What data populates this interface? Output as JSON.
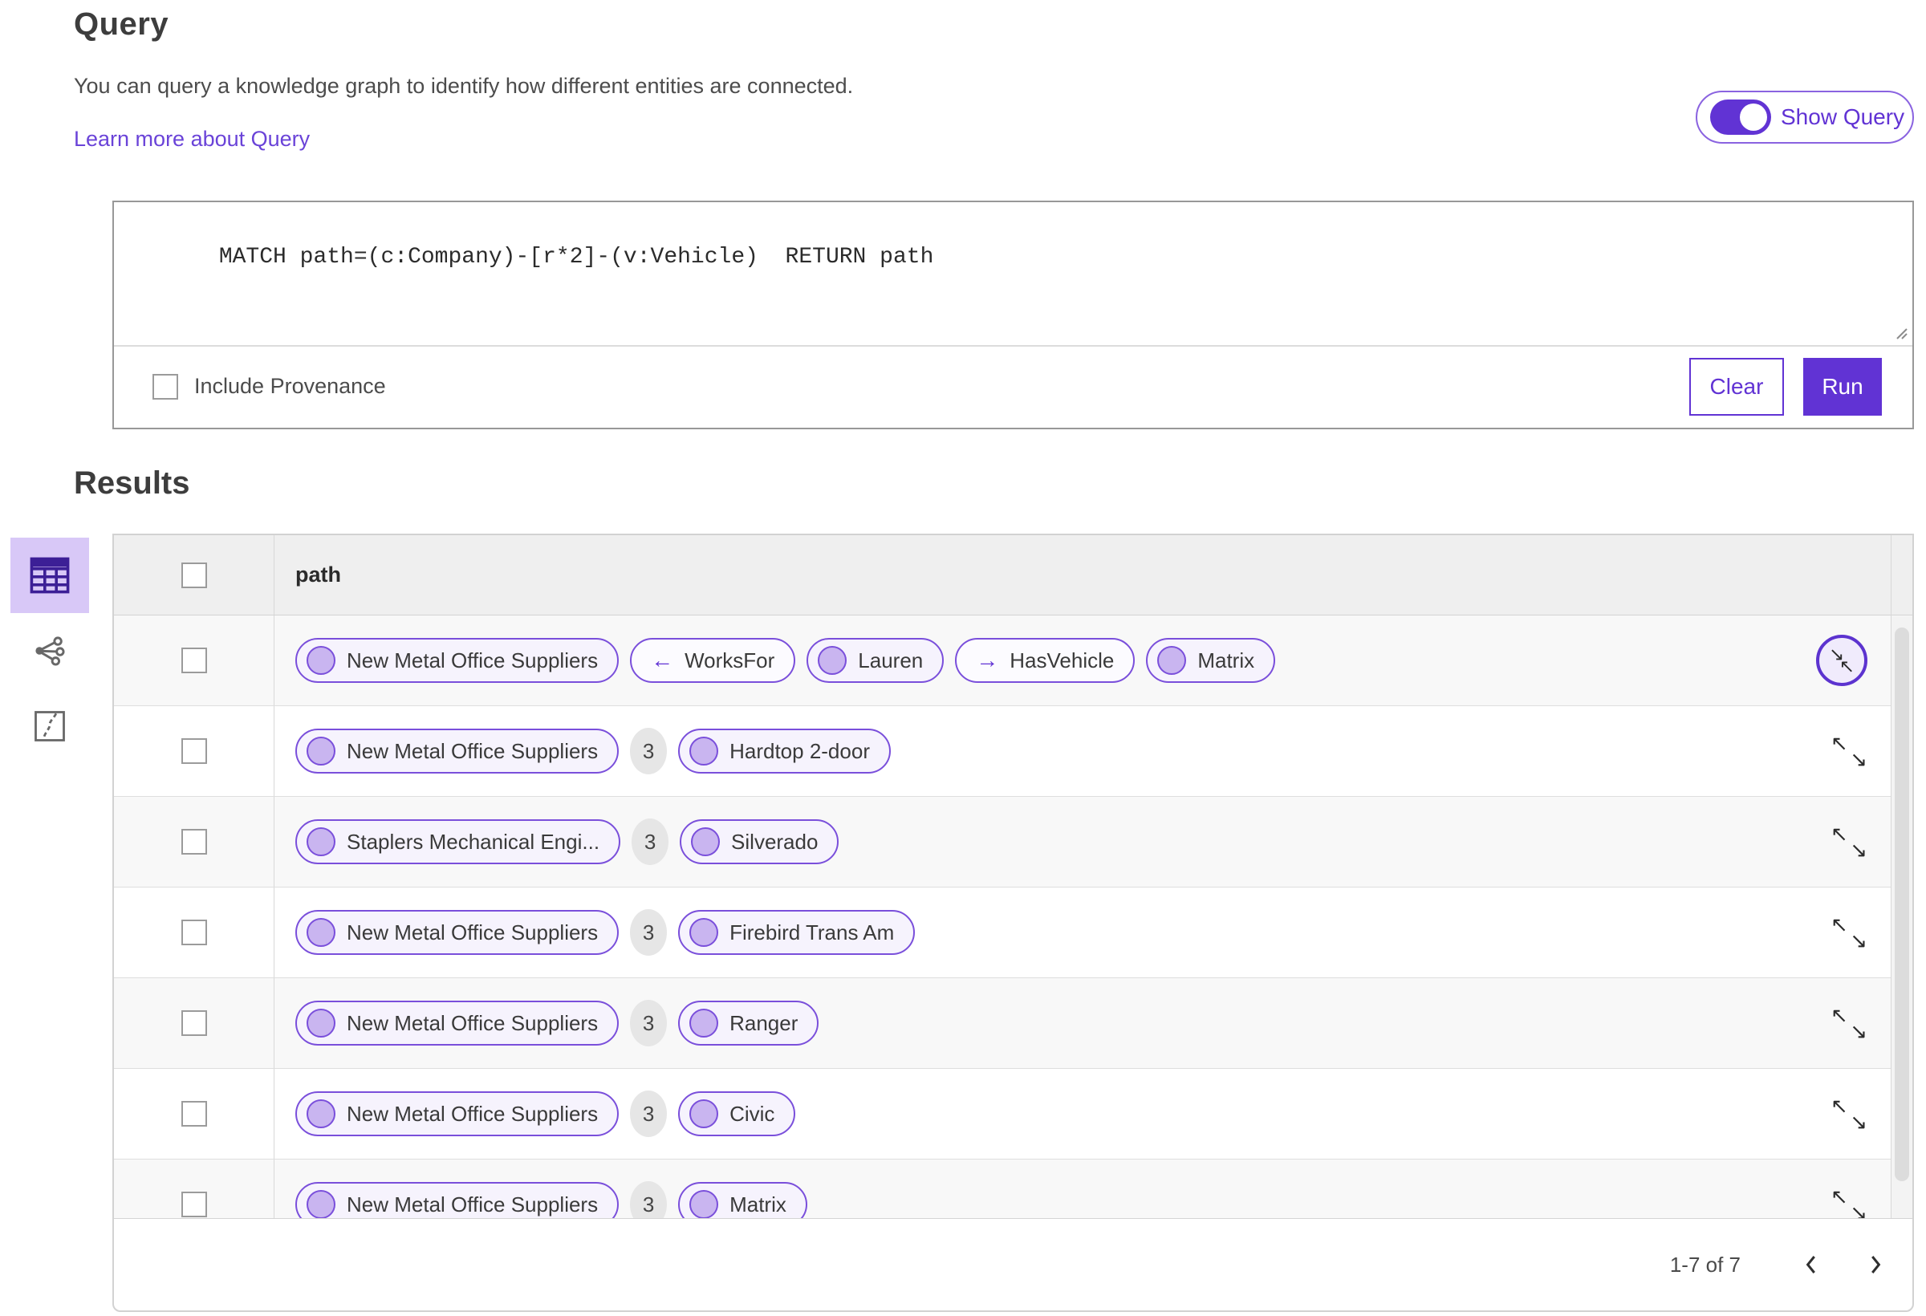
{
  "header": {
    "title": "Query",
    "description": "You can query a knowledge graph to identify how different entities are connected.",
    "learn_more": "Learn more about Query",
    "show_query_label": "Show Query",
    "show_query_on": true
  },
  "query_panel": {
    "query_text": "MATCH path=(c:Company)-[r*2]-(v:Vehicle)  RETURN path",
    "include_provenance_label": "Include Provenance",
    "include_provenance_checked": false,
    "clear_label": "Clear",
    "run_label": "Run"
  },
  "results": {
    "title": "Results",
    "column_header": "path",
    "views": [
      {
        "icon": "table-view-icon",
        "selected": true
      },
      {
        "icon": "link-chart-view-icon",
        "selected": false
      },
      {
        "icon": "map-view-icon",
        "selected": false
      }
    ],
    "rows": [
      {
        "expand": "collapse",
        "cells": [
          {
            "type": "entity",
            "label": "New Metal Office Suppliers"
          },
          {
            "type": "relation",
            "direction": "left",
            "label": "WorksFor"
          },
          {
            "type": "entity",
            "label": "Lauren"
          },
          {
            "type": "relation",
            "direction": "right",
            "label": "HasVehicle"
          },
          {
            "type": "entity",
            "label": "Matrix"
          }
        ]
      },
      {
        "expand": "expand",
        "cells": [
          {
            "type": "entity",
            "label": "New Metal Office Suppliers"
          },
          {
            "type": "count",
            "label": "3"
          },
          {
            "type": "entity",
            "label": "Hardtop 2-door"
          }
        ]
      },
      {
        "expand": "expand",
        "cells": [
          {
            "type": "entity",
            "label": "Staplers Mechanical Engi..."
          },
          {
            "type": "count",
            "label": "3"
          },
          {
            "type": "entity",
            "label": "Silverado"
          }
        ]
      },
      {
        "expand": "expand",
        "cells": [
          {
            "type": "entity",
            "label": "New Metal Office Suppliers"
          },
          {
            "type": "count",
            "label": "3"
          },
          {
            "type": "entity",
            "label": "Firebird Trans Am"
          }
        ]
      },
      {
        "expand": "expand",
        "cells": [
          {
            "type": "entity",
            "label": "New Metal Office Suppliers"
          },
          {
            "type": "count",
            "label": "3"
          },
          {
            "type": "entity",
            "label": "Ranger"
          }
        ]
      },
      {
        "expand": "expand",
        "cells": [
          {
            "type": "entity",
            "label": "New Metal Office Suppliers"
          },
          {
            "type": "count",
            "label": "3"
          },
          {
            "type": "entity",
            "label": "Civic"
          }
        ]
      },
      {
        "expand": "expand",
        "cells": [
          {
            "type": "entity",
            "label": "New Metal Office Suppliers"
          },
          {
            "type": "count",
            "label": "3"
          },
          {
            "type": "entity",
            "label": "Matrix"
          }
        ]
      }
    ],
    "pagination": {
      "range_label": "1-7 of 7"
    }
  },
  "icons": {
    "arrow_left": "←",
    "arrow_right": "→",
    "expand_glyphs": {
      "expand": [
        "↖",
        "↘"
      ],
      "collapse": [
        "↘",
        "↖"
      ]
    }
  },
  "colors": {
    "accent": "#6133d4",
    "pill_border": "#7a4fdb",
    "avatar_fill": "#c9b5f0",
    "selected_view_bg": "#d8c8f7",
    "link": "#6a43d8",
    "header_row_bg": "#efefef",
    "table_border": "#d2d2d2",
    "count_badge_bg": "#e6e6e6"
  }
}
